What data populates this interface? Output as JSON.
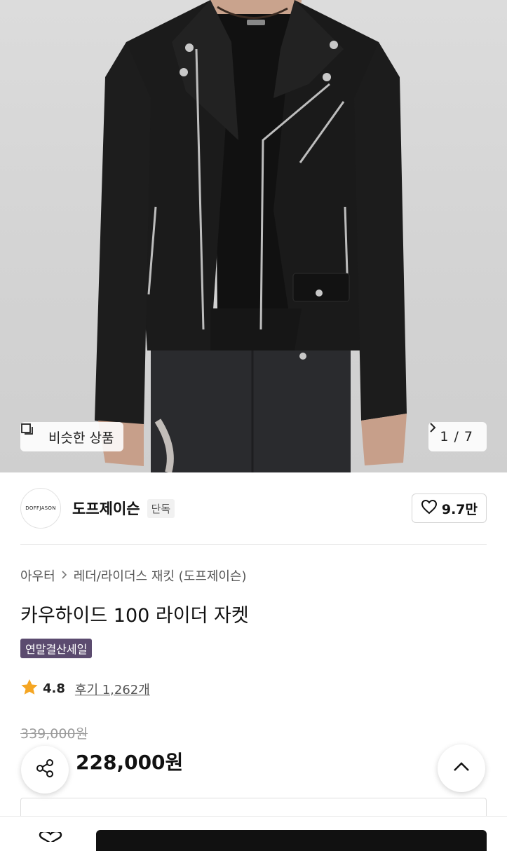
{
  "gallery": {
    "similar_label": "비슷한 상품",
    "current": "1",
    "separator": "/",
    "total": "7"
  },
  "brand": {
    "logo_text": "DOFFJASON",
    "name": "도프제이슨",
    "tag": "단독",
    "likes": "9.7만"
  },
  "breadcrumb": {
    "category": "아우터",
    "subcategory": "레더/라이더스 재킷 (도프제이슨)"
  },
  "product": {
    "title": "카우하이드 100 라이더 자켓",
    "sale_badge": "연말결산세일",
    "rating": "4.8",
    "reviews": "후기 1,262개",
    "original_price": "339,000원",
    "price": "228,000원"
  },
  "colors": {
    "badge_bg": "#5b4b6f",
    "star": "#f5a623",
    "buy_button": "#111111"
  },
  "icons": [
    "similar-icon",
    "chevron-right-icon",
    "heart-icon",
    "star-icon",
    "share-icon",
    "chevron-up-icon"
  ]
}
